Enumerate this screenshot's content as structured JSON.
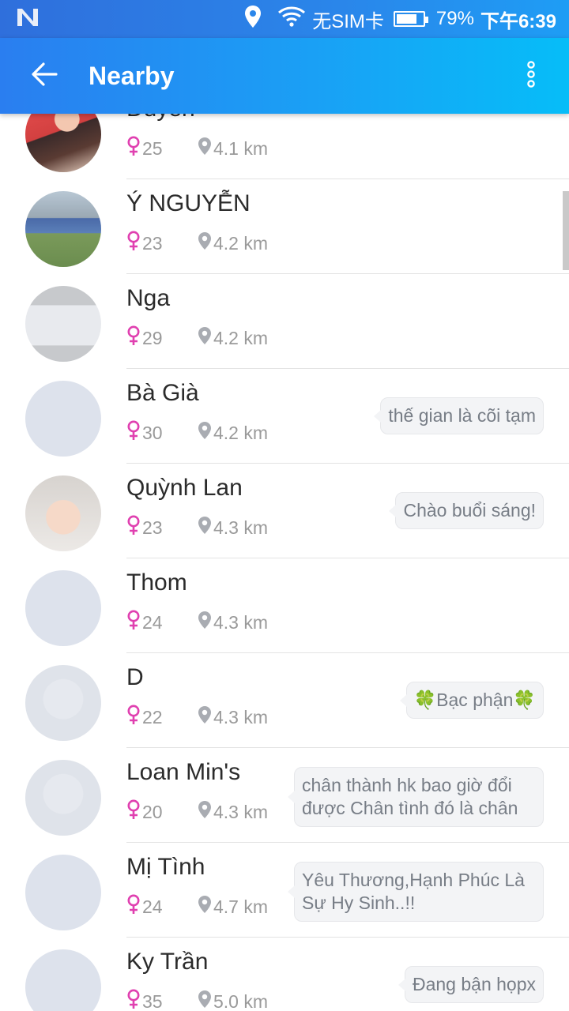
{
  "status_bar": {
    "carrier": "无SIM卡",
    "battery": "79%",
    "battery_level": 0.79,
    "time": "下午6:39",
    "icons": [
      "n-logo-icon",
      "location-icon",
      "wifi-icon",
      "battery-icon"
    ]
  },
  "app_bar": {
    "title": "Nearby",
    "back_icon": "arrow-left-icon",
    "menu_icon": "more-vert-icon"
  },
  "colors": {
    "accent_start": "#2a7ef0",
    "accent_end": "#06bdf8",
    "female": "#e040b0",
    "meta_text": "#9a9a9a"
  },
  "users": [
    {
      "name": "Duyên",
      "age": "25",
      "distance": "4.1 km",
      "status": "",
      "avatar": "photo-woman-glasses"
    },
    {
      "name": "Ý NGUYỄN",
      "age": "23",
      "distance": "4.2 km",
      "status": "",
      "avatar": "photo-outdoor"
    },
    {
      "name": "Nga",
      "age": "29",
      "distance": "4.2 km",
      "status": "",
      "avatar": "screenshot"
    },
    {
      "name": "Bà Già",
      "age": "30",
      "distance": "4.2 km",
      "status": "thế gian là cõi tạm",
      "avatar": "placeholder"
    },
    {
      "name": "Quỳnh Lan",
      "age": "23",
      "distance": "4.3 km",
      "status": "Chào buổi sáng!",
      "avatar": "photo-woman-glasses-light"
    },
    {
      "name": "Thom",
      "age": "24",
      "distance": "4.3 km",
      "status": "",
      "avatar": "placeholder"
    },
    {
      "name": "D",
      "age": "22",
      "distance": "4.3 km",
      "status": "🍀Bạc phận🍀",
      "avatar": "faded-photo"
    },
    {
      "name": "Loan Min's",
      "age": "20",
      "distance": "4.3 km",
      "status": "chân thành hk bao giờ đổi được Chân tình đó là chân",
      "avatar": "faded-photo"
    },
    {
      "name": "Mị Tình",
      "age": "24",
      "distance": "4.7 km",
      "status": "Yêu Thương,Hạnh Phúc Là Sự Hy Sinh..!!",
      "avatar": "placeholder"
    },
    {
      "name": "Ky Trần",
      "age": "35",
      "distance": "5.0 km",
      "status": "Đang bận họpx",
      "avatar": "placeholder"
    }
  ]
}
